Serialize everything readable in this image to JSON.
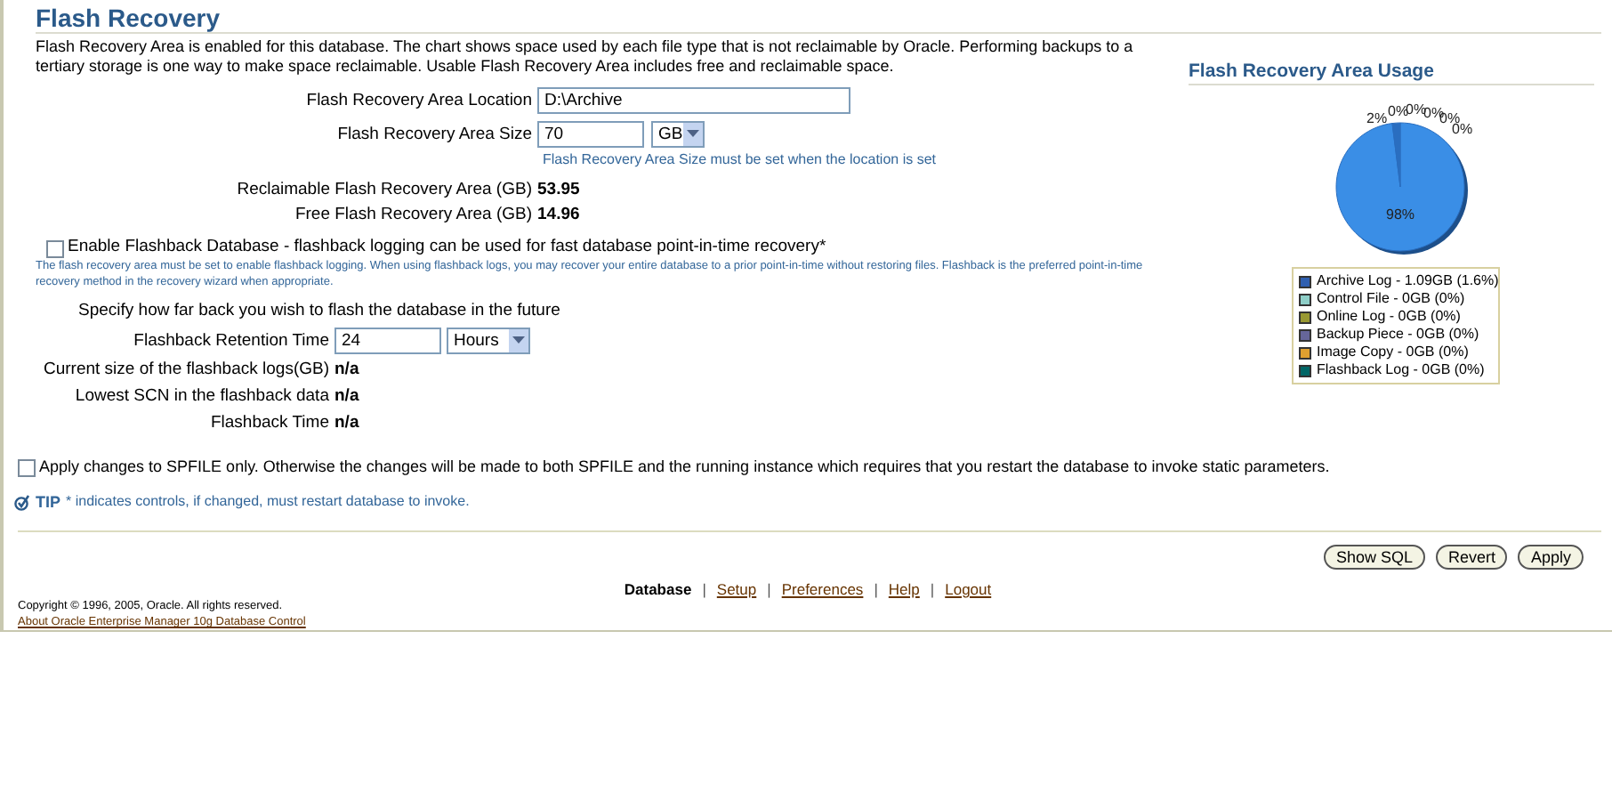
{
  "title": "Flash Recovery",
  "intro": "Flash Recovery Area is enabled for this database. The chart shows space used by each file type that is not reclaimable by Oracle. Performing backups to a tertiary storage is one way to make space reclaimable. Usable Flash Recovery Area includes free and reclaimable space.",
  "location": {
    "label": "Flash Recovery Area Location",
    "value": "D:\\Archive"
  },
  "size": {
    "label": "Flash Recovery Area Size",
    "value": "70",
    "unit": "GB",
    "hint": "Flash Recovery Area Size must be set when the location is set"
  },
  "stats": [
    {
      "label": "Reclaimable Flash Recovery Area (GB)",
      "value": "53.95"
    },
    {
      "label": "Free Flash Recovery Area (GB)",
      "value": "14.96"
    }
  ],
  "flashback": {
    "label": "Enable Flashback Database - flashback logging can be used for fast database point-in-time recovery*",
    "checked": false,
    "hint": "The flash recovery area must be set to enable flashback logging. When using flashback logs, you may recover your entire database to a prior point-in-time without restoring files. Flashback is the preferred point-in-time recovery method in the recovery wizard when appropriate."
  },
  "specify": "Specify how far back you wish to flash the database in the future",
  "retention": {
    "label": "Flashback Retention Time",
    "value": "24",
    "unit": "Hours"
  },
  "flashback_stats": [
    {
      "label": "Current size of the flashback logs(GB)",
      "value": "n/a"
    },
    {
      "label": "Lowest SCN in the flashback data",
      "value": "n/a"
    },
    {
      "label": "Flashback Time",
      "value": "n/a"
    }
  ],
  "spfile": {
    "label": "Apply changes to SPFILE only. Otherwise the changes will be made to both SPFILE and the running instance which requires that you restart the database to invoke static parameters.",
    "checked": false
  },
  "tip": {
    "label": "TIP",
    "text": "* indicates controls, if changed, must restart database to invoke."
  },
  "usage": {
    "title": "Flash Recovery Area Usage",
    "chart_data": {
      "type": "pie",
      "values": [
        98,
        2,
        0,
        0,
        0,
        0,
        0
      ],
      "value_labels": [
        "98%",
        "2%",
        "0%",
        "0%",
        "0%",
        "0%",
        "0%"
      ]
    },
    "legend": [
      {
        "label": "Archive Log - 1.09GB (1.6%)",
        "color": "#2f5fb0"
      },
      {
        "label": "Control File - 0GB (0%)",
        "color": "#8fcfc8"
      },
      {
        "label": "Online Log - 0GB (0%)",
        "color": "#999933"
      },
      {
        "label": "Backup Piece - 0GB (0%)",
        "color": "#666699"
      },
      {
        "label": "Image Copy - 0GB (0%)",
        "color": "#e0a030"
      },
      {
        "label": "Flashback Log - 0GB (0%)",
        "color": "#006666"
      }
    ]
  },
  "buttons": [
    "Show SQL",
    "Revert",
    "Apply"
  ],
  "footer_links": [
    {
      "kind": "link",
      "label": "Database",
      "selected": true
    },
    {
      "kind": "separator",
      "label": "|"
    },
    {
      "kind": "link",
      "label": "Setup",
      "selected": false
    },
    {
      "kind": "separator",
      "label": "|"
    },
    {
      "kind": "link",
      "label": "Preferences",
      "selected": false
    },
    {
      "kind": "separator",
      "label": "|"
    },
    {
      "kind": "link",
      "label": "Help",
      "selected": false
    },
    {
      "kind": "separator",
      "label": "|"
    },
    {
      "kind": "link",
      "label": "Logout",
      "selected": false
    }
  ],
  "copyright": "Copyright © 1996, 2005, Oracle. All rights reserved.",
  "about_link": "About Oracle Enterprise Manager 10g Database Control"
}
